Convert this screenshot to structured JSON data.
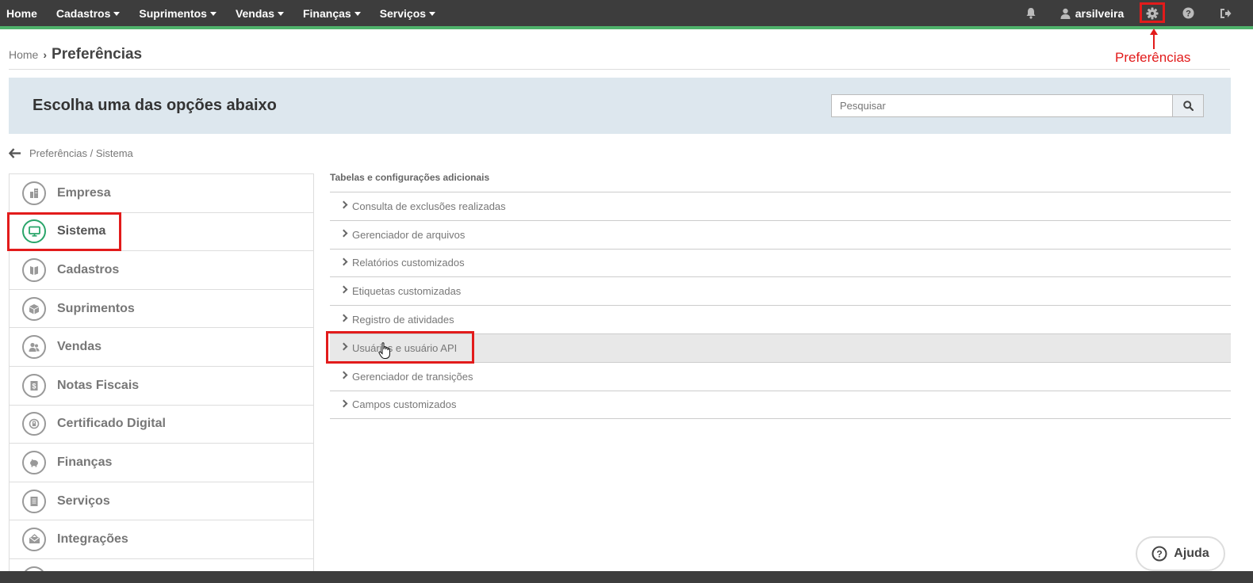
{
  "nav": {
    "home": "Home",
    "menus": [
      "Cadastros",
      "Suprimentos",
      "Vendas",
      "Finanças",
      "Serviços"
    ],
    "user": "arsilveira",
    "icons": [
      "bell-icon",
      "user-icon",
      "gear-icon",
      "question-icon",
      "logout-icon"
    ]
  },
  "breadcrumb": {
    "home": "Home",
    "title": "Preferências"
  },
  "annotation": {
    "label": "Preferências",
    "color": "#e21b1b"
  },
  "banner": {
    "title": "Escolha uma das opções abaixo",
    "search_placeholder": "Pesquisar"
  },
  "subpath": "Preferências / Sistema",
  "menu": {
    "items": [
      {
        "label": "Empresa",
        "icon": "building-icon"
      },
      {
        "label": "Sistema",
        "icon": "monitor-icon"
      },
      {
        "label": "Cadastros",
        "icon": "book-icon"
      },
      {
        "label": "Suprimentos",
        "icon": "box-icon"
      },
      {
        "label": "Vendas",
        "icon": "users-icon"
      },
      {
        "label": "Notas Fiscais",
        "icon": "invoice-icon"
      },
      {
        "label": "Certificado Digital",
        "icon": "certificate-icon"
      },
      {
        "label": "Finanças",
        "icon": "piggy-bank-icon"
      },
      {
        "label": "Serviços",
        "icon": "document-icon"
      },
      {
        "label": "Integrações",
        "icon": "envelope-icon"
      }
    ],
    "active": "Sistema"
  },
  "section": {
    "title": "Tabelas e configurações adicionais",
    "items": [
      "Consulta de exclusões realizadas",
      "Gerenciador de arquivos",
      "Relatórios customizados",
      "Etiquetas customizadas",
      "Registro de atividades",
      "Usuários e usuário API",
      "Gerenciador de transições",
      "Campos customizados"
    ],
    "hovered": "Usuários e usuário API"
  },
  "help": {
    "label": "Ajuda"
  },
  "colors": {
    "nav_bg": "#3d3d3d",
    "accent": "#4fb26b",
    "banner_bg": "#dde7ee",
    "highlight": "#e21b1b"
  }
}
